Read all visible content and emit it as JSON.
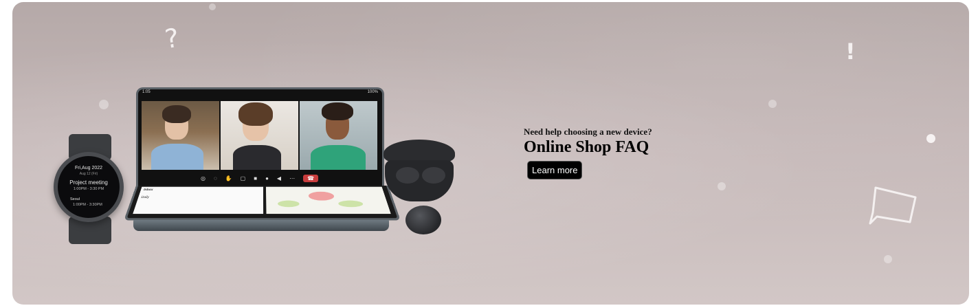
{
  "banner": {
    "eyebrow": "Need help choosing a new device?",
    "title": "Online Shop FAQ",
    "button_label": "Learn more"
  },
  "decorations": {
    "question_mark": "?",
    "exclamation_mark": "!"
  },
  "watch_screen": {
    "date": "Fri,Aug 2022",
    "subdate": "Aug 12 (Fri)",
    "event": "Project meeting",
    "event_time": "1:00PM - 3:30 PM",
    "city": "Seoul",
    "city_time": "1:00PM - 3:30PM"
  },
  "phone_screen": {
    "time": "1:05",
    "battery": "100%",
    "inbox_label": "Inbox",
    "draft_label": "Daily"
  },
  "colors": {
    "background_top": "#b5a9a8",
    "background_bottom": "#d2c7c6",
    "button_bg": "#000000",
    "button_text": "#ffffff"
  }
}
